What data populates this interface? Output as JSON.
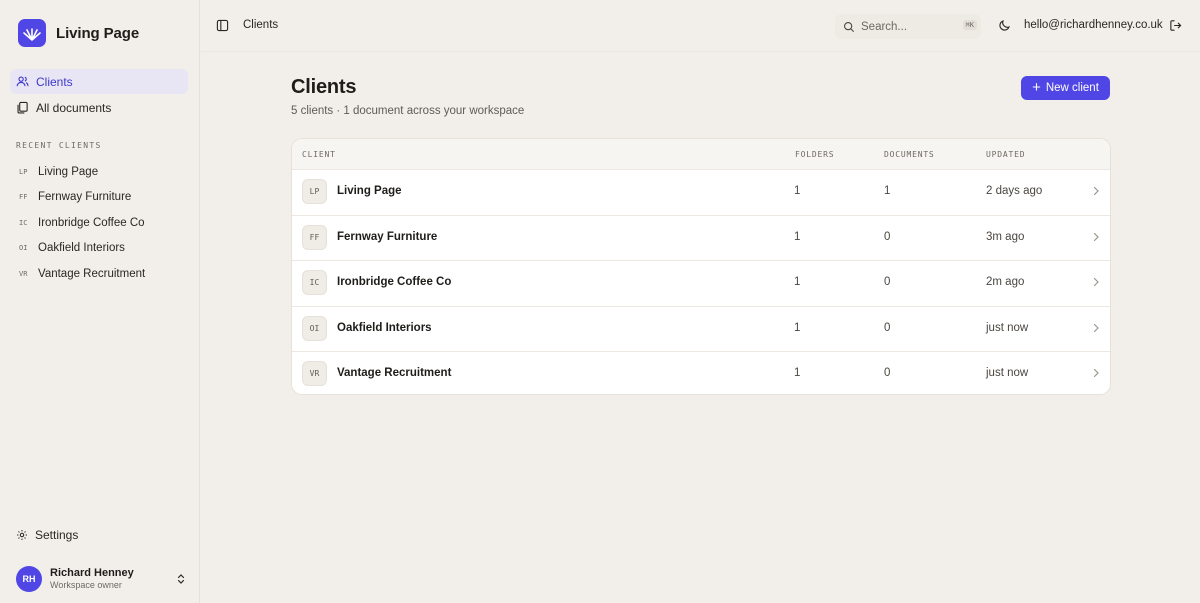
{
  "brand": {
    "name": "Living Page"
  },
  "sidebar": {
    "nav": [
      {
        "label": "Clients",
        "icon": "users-icon",
        "active": true
      },
      {
        "label": "All documents",
        "icon": "documents-icon",
        "active": false
      }
    ],
    "recent_label": "RECENT CLIENTS",
    "recent": [
      {
        "abbr": "LP",
        "name": "Living Page"
      },
      {
        "abbr": "FF",
        "name": "Fernway Furniture"
      },
      {
        "abbr": "IC",
        "name": "Ironbridge Coffee Co"
      },
      {
        "abbr": "OI",
        "name": "Oakfield Interiors"
      },
      {
        "abbr": "VR",
        "name": "Vantage Recruitment"
      }
    ],
    "settings_label": "Settings",
    "user": {
      "initials": "RH",
      "name": "Richard Henney",
      "role": "Workspace owner"
    }
  },
  "topbar": {
    "breadcrumb": "Clients",
    "search_placeholder": "Search...",
    "search_shortcut": "⌘K",
    "email": "hello@richardhenney.co.uk"
  },
  "main": {
    "title": "Clients",
    "subtitle": "5 clients · 1 document across your workspace",
    "new_button": "New client",
    "columns": {
      "client": "CLIENT",
      "folders": "FOLDERS",
      "documents": "DOCUMENTS",
      "updated": "UPDATED"
    },
    "rows": [
      {
        "abbr": "LP",
        "name": "Living Page",
        "folders": "1",
        "documents": "1",
        "updated": "2 days ago"
      },
      {
        "abbr": "FF",
        "name": "Fernway Furniture",
        "folders": "1",
        "documents": "0",
        "updated": "3m ago"
      },
      {
        "abbr": "IC",
        "name": "Ironbridge Coffee Co",
        "folders": "1",
        "documents": "0",
        "updated": "2m ago"
      },
      {
        "abbr": "OI",
        "name": "Oakfield Interiors",
        "folders": "1",
        "documents": "0",
        "updated": "just now"
      },
      {
        "abbr": "VR",
        "name": "Vantage Recruitment",
        "folders": "1",
        "documents": "0",
        "updated": "just now"
      }
    ]
  },
  "colors": {
    "accent": "#4f46e5",
    "background": "#f2efea",
    "active_nav_bg": "#e8e6f5"
  }
}
